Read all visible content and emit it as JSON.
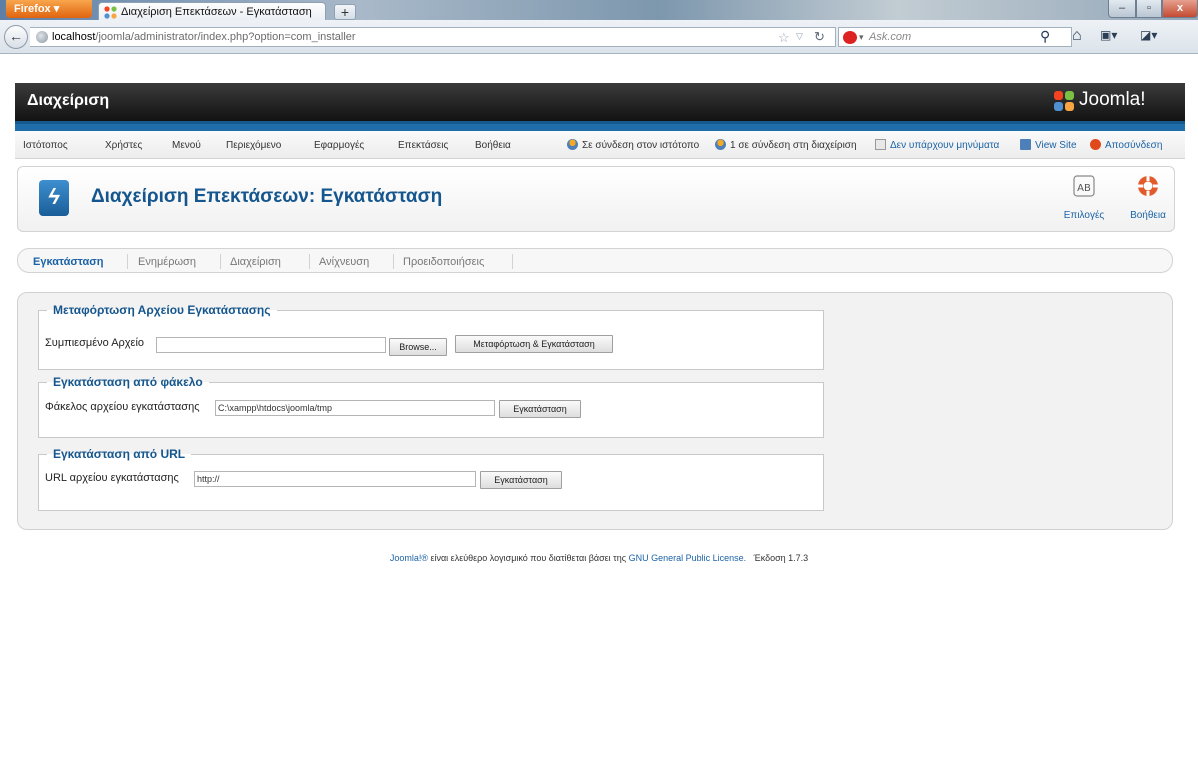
{
  "browser": {
    "menu_label": "Firefox",
    "tab_title": "Διαχείριση Επεκτάσεων - Εγκατάσταση",
    "newtab_label": "+",
    "url_host": "localhost",
    "url_path": "/joomla/administrator/index.php?option=com_installer",
    "search_placeholder": "Ask.com"
  },
  "header": {
    "title": "Διαχείριση",
    "brand": "Joomla!"
  },
  "menu": {
    "items": [
      "Ιστότοπος",
      "Χρήστες",
      "Μενού",
      "Περιεχόμενο",
      "Εφαρμογές",
      "Επεκτάσεις",
      "Βοήθεια"
    ],
    "status": {
      "online_site": "Σε σύνδεση στον ιστότοπο",
      "online_admin": "1 σε σύνδεση στη διαχείριση",
      "messages": "Δεν υπάρχουν μηνύματα",
      "view_site": "View Site",
      "logout": "Αποσύνδεση"
    }
  },
  "toolbar": {
    "page_title": "Διαχείριση Επεκτάσεων: Εγκατάσταση",
    "options_label": "Επιλογές",
    "help_label": "Βοήθεια"
  },
  "submenu": {
    "tabs": [
      "Εγκατάσταση",
      "Ενημέρωση",
      "Διαχείριση",
      "Ανίχνευση",
      "Προειδοποιήσεις"
    ]
  },
  "upload": {
    "legend": "Μεταφόρτωση Αρχείου Εγκατάστασης",
    "label": "Συμπιεσμένο Αρχείο",
    "browse_label": "Browse...",
    "submit_label": "Μεταφόρτωση & Εγκατάσταση"
  },
  "folder": {
    "legend": "Εγκατάσταση από φάκελο",
    "label": "Φάκελος αρχείου εγκατάστασης",
    "value": "C:\\xampp\\htdocs\\joomla/tmp",
    "submit_label": "Εγκατάσταση"
  },
  "url": {
    "legend": "Εγκατάσταση από URL",
    "label": "URL αρχείου εγκατάστασης",
    "value": "http://",
    "submit_label": "Εγκατάσταση"
  },
  "footer": {
    "joomla_link": "Joomla!®",
    "text_mid": " είναι ελεύθερο λογισμικό που διατίθεται βάσει της ",
    "license_link": "GNU General Public License.",
    "version": "Έκδοση 1.7.3"
  },
  "colors": {
    "accent": "#14568d",
    "link": "#1b63a6",
    "header_bg": "#1a1a1a",
    "header_bar": "#1f6ea9",
    "logout_icon": "#e0491b"
  }
}
